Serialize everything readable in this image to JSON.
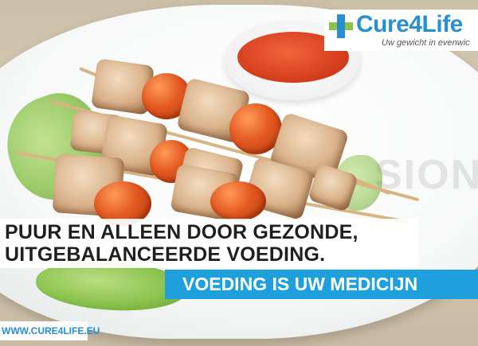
{
  "logo": {
    "name": "Cure4Life",
    "tagline": "Uw gewicht in evenwic",
    "brand_color": "#2a8fd0",
    "cross_color": "#2a8fd0"
  },
  "headline": {
    "line1": "PUUR EN ALLEEN DOOR GEZONDE,",
    "line2": "UITGEBALANCEERDE VOEDING."
  },
  "banner": {
    "text": "VOEDING IS UW MEDICIJN",
    "color": "#1ea0dd"
  },
  "footer": {
    "url": "WWW.CURE4LIFE.EU"
  },
  "watermark": {
    "text": "SION"
  },
  "photo": {
    "subject": "chicken-tomato-skewers-with-dip"
  }
}
